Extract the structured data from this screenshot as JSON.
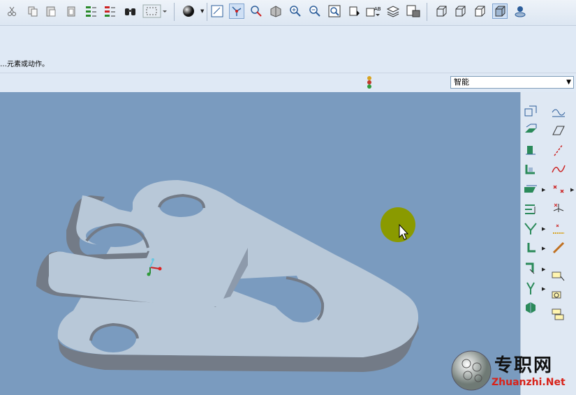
{
  "message": "…元素或动作。",
  "filter": {
    "selected": "智能"
  },
  "watermark": {
    "cn": "专职网",
    "url": "Zhuanzhi.Net"
  },
  "toolbar_icons": [
    "cut-icon",
    "copy-icon",
    "paste-icon",
    "paste-special-icon",
    "regenerate-icon",
    "regen-manager-icon",
    "find-icon",
    "select-box-icon",
    "appearance-icon",
    "repaint-icon",
    "spin-center-icon",
    "view-manager-icon",
    "zoom-in-icon",
    "zoom-out-icon",
    "refit-icon",
    "orient-icon",
    "saved-views-icon",
    "layers-icon",
    "view-manager2-icon",
    "wireframe-icon",
    "hidden-line-icon",
    "no-hidden-icon",
    "shading-icon",
    "annotation-icon"
  ],
  "right_tool_icons": [
    "datum-plane-icon",
    "sketch-icon",
    "extrude-icon",
    "datum-axis-icon",
    "revolve-icon",
    "datum-point-icon",
    "sweep-icon",
    "datum-curve-icon",
    "hole-icon",
    "point-tools-icon",
    "round-icon",
    "coordinate-system-icon",
    "chamfer-icon",
    "analysis-icon",
    "pattern-icon",
    "relation-icon",
    "mirror-icon",
    "copy-feature-icon",
    "merge-icon",
    "annotation-feature-icon",
    "part-icon"
  ]
}
